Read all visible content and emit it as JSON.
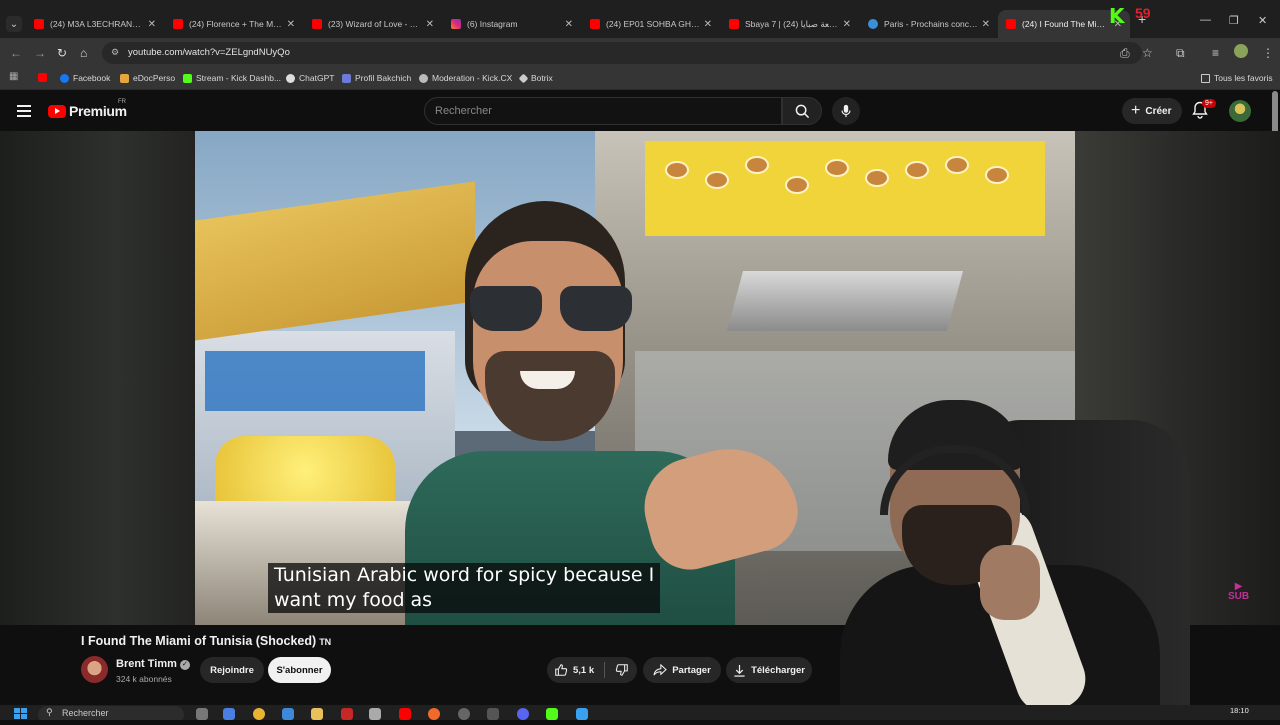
{
  "browser": {
    "tabs": [
      {
        "label": "(24) M3A L3ECHRANE (Re",
        "favicon": "youtube"
      },
      {
        "label": "(24) Florence + The Mach",
        "favicon": "youtube"
      },
      {
        "label": "(23) Wizard of Love - You",
        "favicon": "youtube"
      },
      {
        "label": "(6) Instagram",
        "favicon": "instagram"
      },
      {
        "label": "(24) EP01 SOHBA GHIR D",
        "favicon": "youtube"
      },
      {
        "label": "Sbaya 7 | سبعة صبايا (24)",
        "favicon": "youtube"
      },
      {
        "label": "Paris - Prochains concerts",
        "favicon": "globe"
      },
      {
        "label": "(24) I Found The Miami",
        "favicon": "youtube",
        "active": true
      }
    ],
    "url": "youtube.com/watch?v=ZELgndNUyQo",
    "bookmarks": [
      {
        "label": "",
        "icon": "youtube"
      },
      {
        "label": "Facebook",
        "icon": "facebook"
      },
      {
        "label": "eDocPerso",
        "icon": "edoc"
      },
      {
        "label": "Stream - Kick Dashb...",
        "icon": "kick"
      },
      {
        "label": "ChatGPT",
        "icon": "chatgpt"
      },
      {
        "label": "Profil Bakchich",
        "icon": "bakchich"
      },
      {
        "label": "Moderation - Kick.CX",
        "icon": "gear"
      },
      {
        "label": "Botrix",
        "icon": "botrix"
      }
    ],
    "all_bookmarks": "Tous les favoris"
  },
  "overlay": {
    "kick_letter": "K",
    "viewer_count": "59",
    "sub_logo": "SUB"
  },
  "youtube": {
    "brand": "Premium",
    "region": "FR",
    "search_placeholder": "Rechercher",
    "create_label": "Créer",
    "notif_badge": "9+"
  },
  "video": {
    "caption_line1": "Tunisian Arabic word for spicy because I",
    "caption_line2": "want my food as",
    "title": "I Found The Miami of Tunisia (Shocked)",
    "title_flag": "TN",
    "channel": "Brent Timm",
    "subscribers": "324 k abonnés",
    "join_label": "Rejoindre",
    "subscribe_label": "S'abonner",
    "likes": "5,1 k",
    "share_label": "Partager",
    "download_label": "Télécharger"
  },
  "taskbar": {
    "search_label": "Rechercher",
    "time": "18:10"
  },
  "colors": {
    "youtube_red": "#ff0000",
    "kick_green": "#53fc18",
    "bg": "#0f0f0f"
  }
}
